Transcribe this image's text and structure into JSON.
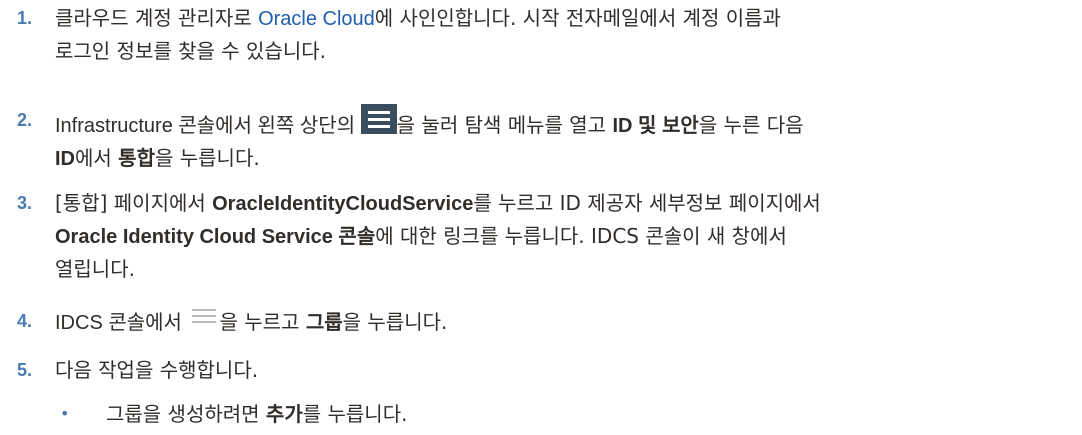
{
  "steps": [
    {
      "number": "1.",
      "line1_pre": "클라우드 계정 관리자로 ",
      "line1_link": "Oracle Cloud",
      "line1_post": "에 사인인합니다. 시작 전자메일에서 계정 이름과",
      "line2": "로그인 정보를 찾을 수 있습니다."
    },
    {
      "number": "2.",
      "line1_pre": "Infrastructure 콘솔에서 왼쪽 상단의 ",
      "icon": "hamburger-menu-icon",
      "line1_mid": "을 눌러 탐색 메뉴를 열고 ",
      "line1_bold": "ID 및 보안",
      "line1_post": "을 누른 다음",
      "line2_bold1": "ID",
      "line2_mid": "에서 ",
      "line2_bold2": "통합",
      "line2_post": "을 누릅니다."
    },
    {
      "number": "3.",
      "line1_pre": "[통합] 페이지에서 ",
      "line1_bold": "OracleIdentityCloudService",
      "line1_post": "를 누르고 ID 제공자 세부정보 페이지에서",
      "line2_bold": "Oracle Identity Cloud Service 콘솔",
      "line2_post": "에 대한 링크를 누릅니다. IDCS 콘솔이 새 창에서",
      "line3": "열립니다."
    },
    {
      "number": "4.",
      "line1_pre": "IDCS 콘솔에서 ",
      "icon": "hamburger-menu-light-icon",
      "line1_mid": "을 누르고 ",
      "line1_bold": "그룹",
      "line1_post": "을 누릅니다."
    },
    {
      "number": "5.",
      "line1": "다음 작업을 수행합니다."
    }
  ],
  "bullets": [
    {
      "marker": "•",
      "pre": "그룹을 생성하려면 ",
      "bold": "추가",
      "post": "를 누릅니다."
    }
  ],
  "colors": {
    "text": "#312d2a",
    "link": "#1f5fad",
    "step_number": "#4a7bb0",
    "menu_icon_dark": "#3a4d5c",
    "menu_icon_light": "#b6bcc2"
  }
}
